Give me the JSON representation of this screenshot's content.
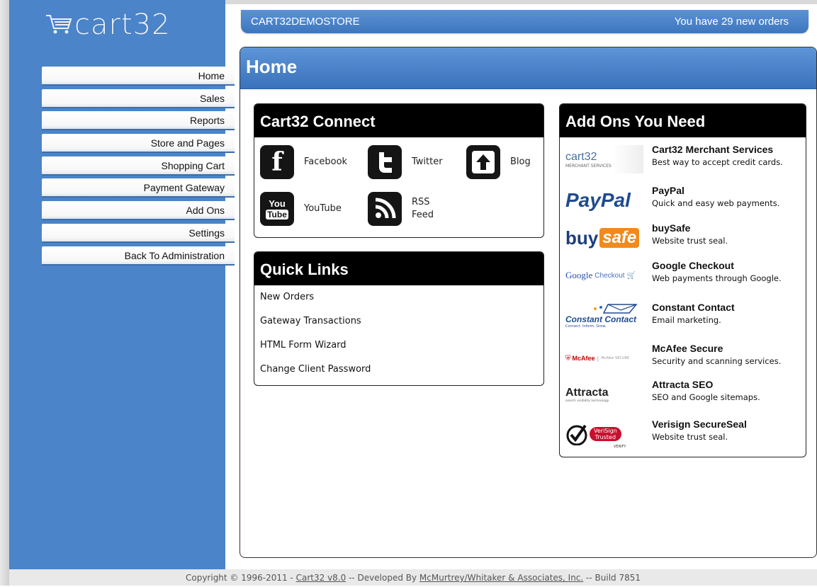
{
  "logo": {
    "text": "cart32"
  },
  "nav": {
    "items": [
      {
        "label": "Home"
      },
      {
        "label": "Sales"
      },
      {
        "label": "Reports"
      },
      {
        "label": "Store and Pages"
      },
      {
        "label": "Shopping Cart"
      },
      {
        "label": "Payment Gateway"
      },
      {
        "label": "Add Ons"
      },
      {
        "label": "Settings"
      },
      {
        "label": "Back To Administration"
      }
    ]
  },
  "topbar": {
    "store": "CART32DEMOSTORE",
    "orders": "You have 29 new orders"
  },
  "main": {
    "title": "Home"
  },
  "connect": {
    "title": "Cart32 Connect",
    "items": [
      {
        "label": "Facebook",
        "icon": "facebook-icon"
      },
      {
        "label": "Twitter",
        "icon": "twitter-icon"
      },
      {
        "label": "Blog",
        "icon": "blog-up-arrow-icon"
      },
      {
        "label": "YouTube",
        "icon": "youtube-icon"
      },
      {
        "label_line1": "RSS",
        "label_line2": "Feed",
        "icon": "rss-icon"
      }
    ]
  },
  "quick": {
    "title": "Quick Links",
    "links": [
      {
        "label": "New Orders"
      },
      {
        "label": "Gateway Transactions"
      },
      {
        "label": "HTML Form Wizard"
      },
      {
        "label": "Change Client Password"
      }
    ]
  },
  "addons": {
    "title": "Add Ons You Need",
    "items": [
      {
        "name": "Cart32 Merchant Services",
        "desc": "Best way to accept credit cards.",
        "logo": "cart32",
        "logo_sub": "MERCHANT SERVICES"
      },
      {
        "name": "PayPal",
        "desc": "Quick and easy web payments.",
        "logo": "PayPal"
      },
      {
        "name": "buySafe",
        "desc": "Website trust seal.",
        "logo_a": "buy",
        "logo_b": "safe"
      },
      {
        "name": "Google Checkout",
        "desc": "Web payments through Google.",
        "logo_a": "Google",
        "logo_b": "Checkout"
      },
      {
        "name": "Constant Contact",
        "desc": "Email marketing.",
        "logo": "Constant Contact",
        "logo_sub": "Connect. Inform. Grow."
      },
      {
        "name": "McAfee Secure",
        "desc": "Security and scanning services.",
        "logo_a": "McAfee",
        "logo_b": "McAfee SECURE"
      },
      {
        "name": "Attracta SEO",
        "desc": "SEO and Google sitemaps.",
        "logo": "Attracta",
        "logo_sub": "search visibility technology"
      },
      {
        "name": "Verisign SecureSeal",
        "desc": "Website trust seal.",
        "logo_a": "VeriSign",
        "logo_b": "Trusted",
        "logo_c": "VERIFY"
      }
    ]
  },
  "footer": {
    "prefix": "Copyright © 1996-2011 - ",
    "version_link": "Cart32 v8.0",
    "middle": " -- Developed By ",
    "dev_link": "McMurtrey/Whitaker & Associates, Inc.",
    "suffix": " -- Build 7851"
  },
  "colors": {
    "accent": "#4b84c8",
    "header_dark": "#000000"
  }
}
